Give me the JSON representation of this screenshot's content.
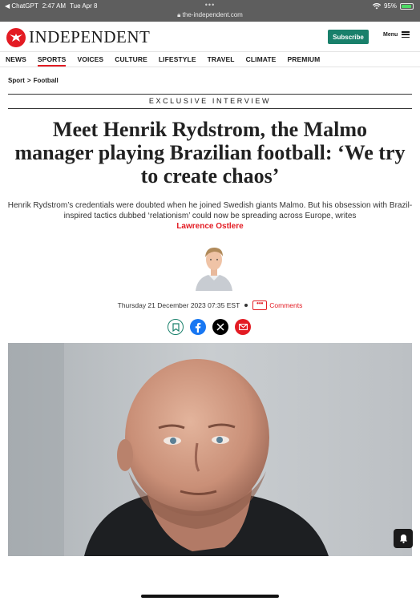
{
  "status_bar": {
    "back_app": "◀ ChatGPT",
    "time": "2:47 AM",
    "date": "Tue Apr 8",
    "battery_percent": "95%",
    "battery_level": 0.95,
    "url": "the-independent.com",
    "tab_dots": "•••"
  },
  "masthead": {
    "logo_text": "INDEPENDENT",
    "subscribe_label": "Subscribe",
    "menu_label": "Menu"
  },
  "nav": {
    "items": [
      "NEWS",
      "SPORTS",
      "VOICES",
      "CULTURE",
      "LIFESTYLE",
      "TRAVEL",
      "CLIMATE",
      "PREMIUM"
    ],
    "active": "SPORTS"
  },
  "breadcrumb": {
    "section": "Sport",
    "separator": ">",
    "subsection": "Football"
  },
  "article": {
    "kicker": "EXCLUSIVE INTERVIEW",
    "headline": "Meet Henrik Rydstrom, the Malmo manager playing Brazilian football: ‘We try to create chaos’",
    "standfirst": "Henrik Rydstrom’s credentials were doubted when he joined Swedish giants Malmo. But his obsession with Brazil-inspired tactics dubbed ‘relationism’ could now be spreading across Europe, writes",
    "author": "Lawrence Ostlere",
    "date": "Thursday 21 December 2023 07:35 EST",
    "comments_label": "Comments",
    "comments_icon_glyph": "•••"
  },
  "share": [
    {
      "name": "bookmark-icon",
      "color": "#19806b"
    },
    {
      "name": "facebook-icon",
      "color": "#1877f2"
    },
    {
      "name": "x-icon",
      "color": "#000000"
    },
    {
      "name": "email-icon",
      "color": "#e31b23"
    }
  ],
  "colors": {
    "brand_red": "#e31b23",
    "subscribe_green": "#19806b"
  }
}
